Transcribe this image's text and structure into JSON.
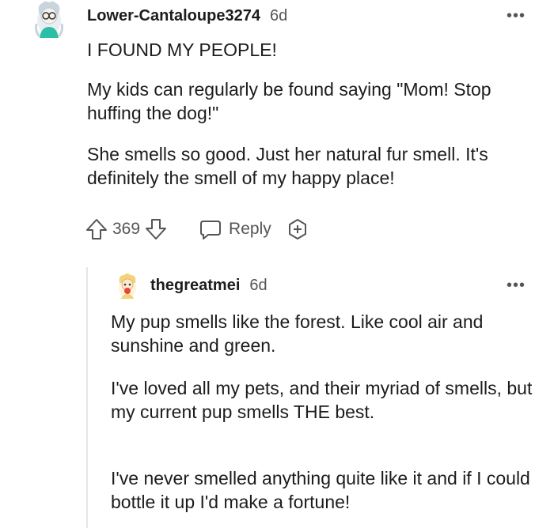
{
  "comment": {
    "author": "Lower-Cantaloupe3274",
    "age": "6d",
    "more": "•••",
    "paragraphs": [
      "I FOUND MY PEOPLE!",
      "My kids can regularly be found saying \"Mom! Stop huffing the dog!\"",
      "She smells so good. Just her natural fur smell. It's definitely the smell of my happy place!"
    ],
    "vote_count": "369",
    "reply_label": "Reply"
  },
  "reply": {
    "author": "thegreatmei",
    "age": "6d",
    "more": "•••",
    "paragraphs": [
      "My pup smells like the forest. Like cool air and sunshine and green.",
      "I've loved all my pets, and their myriad of smells, but my current pup smells THE best.",
      "I've never smelled anything quite like it and if I could bottle it up I'd make a fortune!"
    ]
  },
  "icons": {
    "upvote": "upvote-icon",
    "downvote": "downvote-icon",
    "reply": "reply-bubble-icon",
    "award": "award-plus-icon",
    "more": "more-options-icon"
  }
}
